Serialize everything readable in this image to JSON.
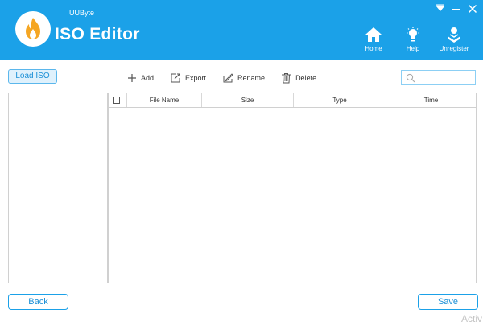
{
  "app": {
    "brand_small": "UUByte",
    "title": "ISO Editor"
  },
  "colors": {
    "accent": "#1ba1e8",
    "flame": "#f5a623"
  },
  "window_controls": [
    {
      "icon": "menu-dropdown-icon"
    },
    {
      "icon": "minimize-icon"
    },
    {
      "icon": "close-icon"
    }
  ],
  "header_buttons": {
    "home": {
      "label": "Home",
      "icon": "home-icon"
    },
    "help": {
      "label": "Help",
      "icon": "lightbulb-icon"
    },
    "unregister": {
      "label": "Unregister",
      "icon": "unregister-icon"
    }
  },
  "load_iso_label": "Load ISO",
  "toolbar": {
    "add": {
      "label": "Add",
      "icon": "plus-icon"
    },
    "export": {
      "label": "Export",
      "icon": "export-icon"
    },
    "rename": {
      "label": "Rename",
      "icon": "rename-icon"
    },
    "delete": {
      "label": "Delete",
      "icon": "trash-icon"
    }
  },
  "search": {
    "value": "",
    "icon": "search-icon"
  },
  "table": {
    "columns": [
      "File Name",
      "Size",
      "Type",
      "Time"
    ],
    "rows": []
  },
  "footer": {
    "back_label": "Back",
    "save_label": "Save"
  },
  "watermark": "Activ"
}
